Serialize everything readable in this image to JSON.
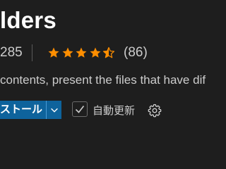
{
  "extension": {
    "title_visible": "lders",
    "installs_visible": "285",
    "rating": {
      "value": 4.5,
      "max": 5,
      "count_text": "(86)"
    },
    "description_visible": "contents, present the files that have dif"
  },
  "actions": {
    "install_label_visible": "ストール",
    "auto_update_label": "自動更新",
    "auto_update_checked": true
  },
  "icons": {
    "star_full": "star-icon",
    "star_half": "star-half-icon",
    "dropdown": "chevron-down-icon",
    "check": "check-icon",
    "settings": "gear-icon"
  },
  "colors": {
    "background": "#1e1e1e",
    "star": "#ff8e00",
    "install_button": "#0e639c",
    "text": "#cccccc",
    "title": "#ffffff"
  }
}
